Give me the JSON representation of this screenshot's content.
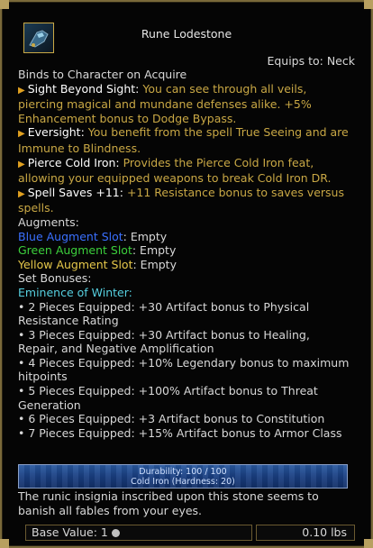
{
  "item": {
    "name": "Rune Lodestone",
    "equips_to": "Equips to: Neck",
    "binding": "Binds to Character on Acquire",
    "icon": "rune-lodestone-icon"
  },
  "effects": [
    {
      "name": "Sight Beyond Sight:",
      "desc": "You can see through all veils, piercing magical and mundane defenses alike. +5% Enhancement bonus to Dodge Bypass."
    },
    {
      "name": "Eversight:",
      "desc": "You benefit from the spell True Seeing and are Immune to Blindness."
    },
    {
      "name": "Pierce Cold Iron:",
      "desc": "Provides the Pierce Cold Iron feat, allowing your equipped weapons to break Cold Iron DR."
    },
    {
      "name": "Spell Saves +11:",
      "desc": "+11 Resistance bonus to saves versus spells."
    }
  ],
  "augments": {
    "header": "Augments:",
    "blue": {
      "label": "Blue Augment Slot",
      "value": ": Empty"
    },
    "green": {
      "label": "Green Augment Slot",
      "value": ": Empty"
    },
    "yellow": {
      "label": "Yellow Augment Slot",
      "value": ": Empty"
    }
  },
  "set": {
    "header": "Set Bonuses:",
    "name": "Eminence of Winter:",
    "bonuses": [
      "• 2 Pieces Equipped: +30 Artifact bonus to Physical Resistance Rating",
      "• 3 Pieces Equipped: +30 Artifact bonus to Healing, Repair, and Negative Amplification",
      "• 4 Pieces Equipped: +10% Legendary bonus to maximum hitpoints",
      "• 5 Pieces Equipped: +100% Artifact bonus to Threat Generation",
      "• 6 Pieces Equipped: +3 Artifact bonus to Constitution",
      "• 7 Pieces Equipped: +15% Artifact bonus to Armor Class"
    ]
  },
  "durability": {
    "text": "Durability: 100 / 100",
    "material": "Cold Iron (Hardness: 20)",
    "fraction": 1.0
  },
  "description": "The runic insignia inscribed upon this stone seems to banish all fables from your eyes.",
  "footer": {
    "base_value": "Base Value: 1",
    "weight": "0.10 lbs"
  },
  "colors": {
    "frame": "#7a6a3a",
    "effect_desc": "#c9a845",
    "blue_slot": "#3a70ff",
    "green_slot": "#3ccf3c",
    "yellow_slot": "#e6c84a",
    "set_name": "#56d0e0"
  }
}
